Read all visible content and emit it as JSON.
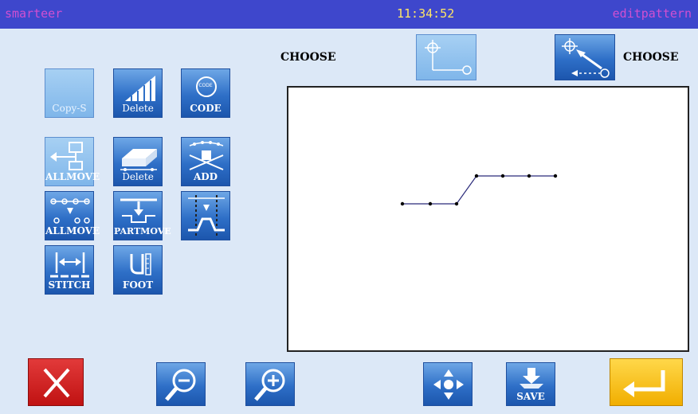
{
  "header": {
    "app_name": "smarteer",
    "clock": "11:34:52",
    "mode": "editpattern"
  },
  "choose": {
    "left_label": "CHOOSE",
    "right_label": "CHOOSE"
  },
  "buttons": {
    "copy_s": "Copy-S",
    "delete_1": "Delete",
    "code": "CODE",
    "allmove_1": "ALLMOVE",
    "delete_2": "Delete",
    "add": "ADD",
    "allmove_2": "ALLMOVE",
    "partmove": "PARTMOVE",
    "stitch": "STITCH",
    "foot": "FOOT",
    "save": "SAVE",
    "code_badge": "CODE"
  },
  "colors": {
    "topbar": "#3e47cc",
    "button_blue": "#2e6fc7",
    "cancel_red": "#d91f1f",
    "enter_yellow": "#f5b800",
    "background": "#dce8f7"
  }
}
